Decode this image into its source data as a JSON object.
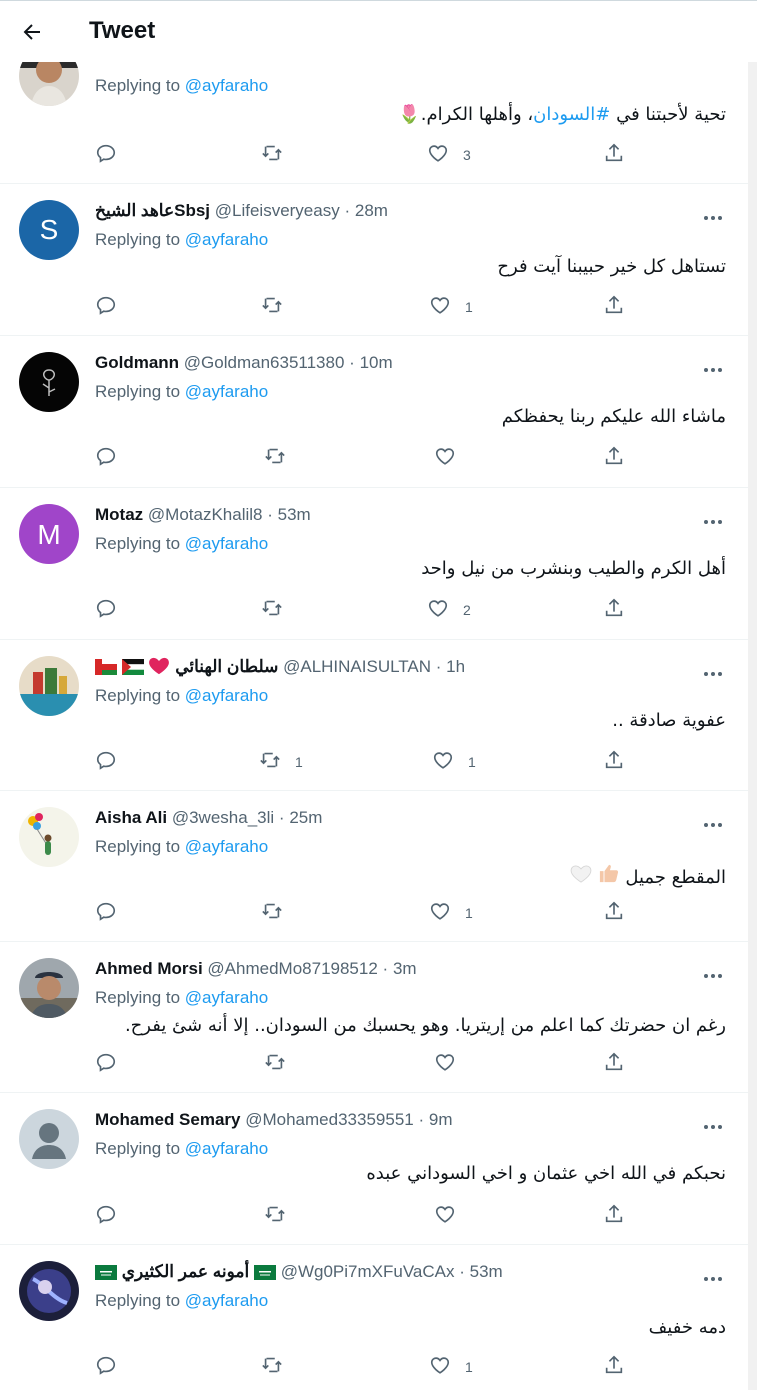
{
  "header": {
    "title": "Tweet"
  },
  "tweets": [
    {
      "name": "",
      "handle": "",
      "time": "",
      "replying_label": "Replying to",
      "replying_to": "@ayfaraho",
      "text_parts": [
        "تحية لأحبتنا في ",
        "#السودان",
        "، وأهلها الكرام."
      ],
      "emoji": "🌷",
      "replies": "",
      "retweets": "",
      "likes": "3"
    },
    {
      "name": "عاهد الشيخSbsj",
      "handle": "@Lifeisveryeasy",
      "time": "28m",
      "replying_label": "Replying to",
      "replying_to": "@ayfaraho",
      "text": "تستاهل كل خير حبيبنا آيت فرح",
      "replies": "",
      "retweets": "",
      "likes": "1"
    },
    {
      "name": "Goldmann",
      "handle": "@Goldman63511380",
      "time": "10m",
      "replying_label": "Replying to",
      "replying_to": "@ayfaraho",
      "text": "ماشاء الله عليكم ربنا يحفظكم",
      "replies": "",
      "retweets": "",
      "likes": ""
    },
    {
      "name": "Motaz",
      "handle": "@MotazKhalil8",
      "time": "53m",
      "replying_label": "Replying to",
      "replying_to": "@ayfaraho",
      "text": "أهل الكرم والطيب وبنشرب من نيل واحد",
      "replies": "",
      "retweets": "",
      "likes": "2"
    },
    {
      "name": "سلطان الهنائي",
      "handle": "@ALHINAISULTAN",
      "time": "1h",
      "replying_label": "Replying to",
      "replying_to": "@ayfaraho",
      "text": "عفوية صادقة ..",
      "replies": "",
      "retweets": "1",
      "likes": "1"
    },
    {
      "name": "Aisha Ali",
      "handle": "@3wesha_3li",
      "time": "25m",
      "replying_label": "Replying to",
      "replying_to": "@ayfaraho",
      "text": "المقطع جميل",
      "replies": "",
      "retweets": "",
      "likes": "1"
    },
    {
      "name": "Ahmed Morsi",
      "handle": "@AhmedMo87198512",
      "time": "3m",
      "replying_label": "Replying to",
      "replying_to": "@ayfaraho",
      "text": "رغم ان حضرتك كما اعلم من إريتريا. وهو يحسبك من السودان.. إلا أنه شئ يفرح.",
      "replies": "",
      "retweets": "",
      "likes": ""
    },
    {
      "name": "Mohamed Semary",
      "handle": "@Mohamed33359551",
      "time": "9m",
      "replying_label": "Replying to",
      "replying_to": "@ayfaraho",
      "text": "نحبكم في الله اخي عثمان و اخي السوداني عبده",
      "replies": "",
      "retweets": "",
      "likes": ""
    },
    {
      "name": "أمونه عمر الكثيري",
      "handle": "@Wg0Pi7mXFuVaCAx",
      "time": "53m",
      "replying_label": "Replying to",
      "replying_to": "@ayfaraho",
      "text": "دمه خفيف",
      "replies": "",
      "retweets": "",
      "likes": "1"
    }
  ],
  "avatars": {
    "lifeisveryeasy_letter": "S",
    "motaz_letter": "M"
  },
  "colors": {
    "accent": "#1d9bf0",
    "text": "#0f1419",
    "muted": "#536471",
    "divider": "#eff3f4"
  },
  "separator": "·"
}
